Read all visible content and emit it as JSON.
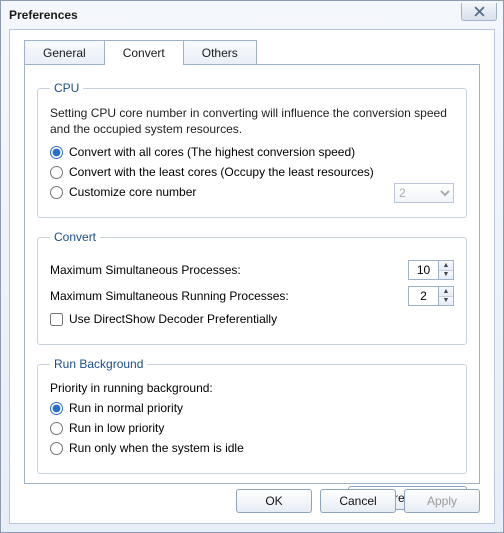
{
  "window": {
    "title": "Preferences"
  },
  "tabs": {
    "general": "General",
    "convert": "Convert",
    "others": "Others"
  },
  "cpu": {
    "legend": "CPU",
    "desc": "Setting CPU core number in converting will influence the conversion speed and the occupied system resources.",
    "opt_all": "Convert with all cores (The highest conversion speed)",
    "opt_least": "Convert with the least cores (Occupy the least resources)",
    "opt_custom": "Customize core number",
    "core_value": "2"
  },
  "convert": {
    "legend": "Convert",
    "max_proc_label": "Maximum Simultaneous Processes:",
    "max_proc_value": "10",
    "max_run_label": "Maximum Simultaneous Running Processes:",
    "max_run_value": "2",
    "directshow": "Use DirectShow Decoder Preferentially"
  },
  "runbg": {
    "legend": "Run Background",
    "heading": "Priority in running background:",
    "opt_normal": "Run in normal priority",
    "opt_low": "Run in low priority",
    "opt_idle": "Run only when the system is idle"
  },
  "buttons": {
    "restore": "Restore Defaults",
    "ok": "OK",
    "cancel": "Cancel",
    "apply": "Apply"
  }
}
